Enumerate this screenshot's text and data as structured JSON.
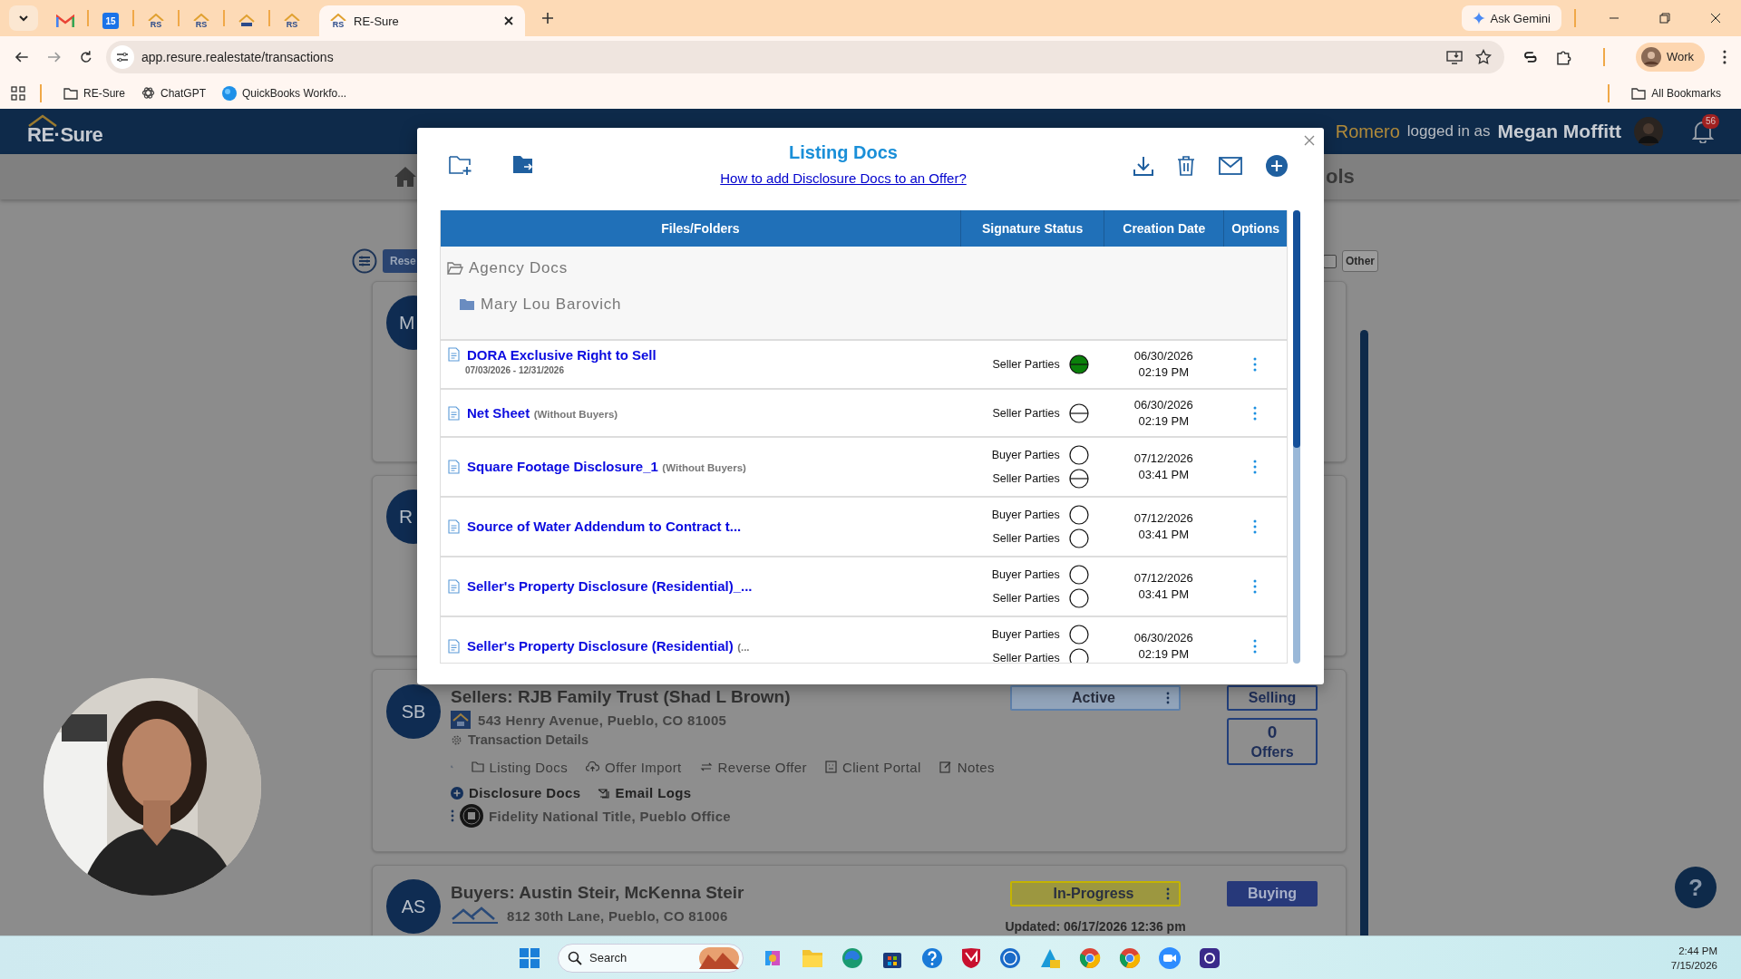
{
  "browser": {
    "tabs": [
      {
        "kind": "gmail",
        "selected": false
      },
      {
        "kind": "calendar",
        "label": "15",
        "selected": false
      },
      {
        "kind": "rs",
        "label": "RS",
        "selected": false
      },
      {
        "kind": "rs",
        "label": "RS",
        "selected": false
      },
      {
        "kind": "resure",
        "selected": false
      },
      {
        "kind": "rs",
        "label": "RS",
        "selected": false
      },
      {
        "kind": "rs",
        "label": "RS",
        "title": "RE-Sure",
        "selected": true
      }
    ],
    "gemini": "Ask Gemini",
    "url": "app.resure.realestate/transactions",
    "profile": "Work",
    "bookmarks": [
      {
        "kind": "folder",
        "label": "RE-Sure"
      },
      {
        "kind": "chatgpt",
        "label": "ChatGPT"
      },
      {
        "kind": "quickbooks",
        "label": "QuickBooks Workfo..."
      }
    ],
    "all_bookmarks": "All Bookmarks"
  },
  "header": {
    "logo": "RE·Sure",
    "user_part": "Romero",
    "logged_in_label": "logged in as",
    "user_name": "Megan Moffitt",
    "notifications": "56"
  },
  "nav": {
    "cut_label": "ols"
  },
  "filters": {
    "reset": "Rese",
    "other": {
      "label": "Other",
      "checked": false
    }
  },
  "cards": [
    {
      "initials": "M"
    },
    {
      "initials": "R"
    },
    {
      "initials": "SB",
      "title": "Sellers: RJB Family Trust (Shad L Brown)",
      "address": "543 Henry Avenue, Pueblo, CO 81005",
      "details": "Transaction Details",
      "actions": [
        {
          "kind": "folder",
          "label": "Listing Docs"
        },
        {
          "kind": "cloud",
          "label": "Offer Import"
        },
        {
          "kind": "swap",
          "label": "Reverse Offer"
        },
        {
          "kind": "portal",
          "label": "Client Portal"
        },
        {
          "kind": "note",
          "label": "Notes"
        }
      ],
      "links": [
        {
          "kind": "plus",
          "label": "Disclosure Docs"
        },
        {
          "kind": "mail",
          "label": "Email Logs"
        }
      ],
      "title_company": "Fidelity National Title, Pueblo Office",
      "status": {
        "kind": "active",
        "label": "Active"
      },
      "side": {
        "kind": "outline",
        "label": "Selling"
      },
      "offers": {
        "count": "0",
        "label": "Offers"
      }
    },
    {
      "initials": "AS",
      "title": "Buyers: Austin Steir, McKenna Steir",
      "address": "812 30th Lane, Pueblo, CO 81006",
      "status": {
        "kind": "progress",
        "label": "In-Progress"
      },
      "updated": "Updated: 06/17/2026 12:36 pm",
      "side": {
        "kind": "filled",
        "label": "Buying"
      }
    }
  ],
  "modal": {
    "title": "Listing Docs",
    "help_link": "How to add Disclosure Docs to an Offer?",
    "columns": [
      "Files/Folders",
      "Signature Status",
      "Creation Date",
      "Options"
    ],
    "folders": [
      {
        "name": "Agency Docs",
        "expanded": true,
        "children": [
          {
            "name": "Mary Lou Barovich",
            "expanded": false
          }
        ]
      }
    ],
    "files": [
      {
        "name": "DORA Exclusive Right to Sell",
        "dates": "07/03/2026 - 12/31/2026",
        "parties": [
          {
            "label": "Seller Parties",
            "sent": true,
            "signed": true
          }
        ],
        "date": "06/30/2026",
        "time": "02:19 PM"
      },
      {
        "name": "Net Sheet",
        "note": "(Without Buyers)",
        "parties": [
          {
            "label": "Seller Parties",
            "sent": true,
            "signed": false
          }
        ],
        "date": "06/30/2026",
        "time": "02:19 PM"
      },
      {
        "name": "Square Footage Disclosure_1",
        "note": "(Without Buyers)",
        "parties": [
          {
            "label": "Buyer Parties",
            "sent": false,
            "signed": false
          },
          {
            "label": "Seller Parties",
            "sent": true,
            "signed": false
          }
        ],
        "date": "07/12/2026",
        "time": "03:41 PM"
      },
      {
        "name": "Source of Water Addendum to Contract t...",
        "parties": [
          {
            "label": "Buyer Parties",
            "sent": false,
            "signed": false
          },
          {
            "label": "Seller Parties",
            "sent": false,
            "signed": false
          }
        ],
        "date": "07/12/2026",
        "time": "03:41 PM"
      },
      {
        "name": "Seller's Property Disclosure (Residential)_...",
        "parties": [
          {
            "label": "Buyer Parties",
            "sent": false,
            "signed": false
          },
          {
            "label": "Seller Parties",
            "sent": false,
            "signed": false
          }
        ],
        "date": "07/12/2026",
        "time": "03:41 PM"
      },
      {
        "name": "Seller's Property Disclosure (Residential)",
        "note": "(...",
        "parties": [
          {
            "label": "Buyer Parties",
            "sent": false,
            "signed": false
          },
          {
            "label": "Seller Parties",
            "sent": false,
            "signed": false
          }
        ],
        "date": "06/30/2026",
        "time": "02:19 PM"
      }
    ]
  },
  "help": "?",
  "taskbar": {
    "search": "Search",
    "time": "2:44 PM",
    "date": "7/15/2026"
  }
}
